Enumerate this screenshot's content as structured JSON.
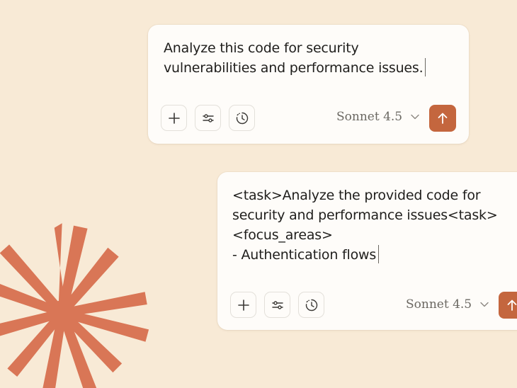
{
  "colors": {
    "background": "#f8ead6",
    "card": "#fefcf9",
    "accent": "#c4663e",
    "starburst": "#d97656",
    "text": "#1f1e1c",
    "muted": "#6b6862"
  },
  "cards": [
    {
      "prompt_lines": [
        "Analyze this code for security",
        "vulnerabilities and performance issues."
      ],
      "tools": [
        "plus-icon",
        "sliders-icon",
        "history-clock-icon"
      ],
      "model_label": "Sonnet 4.5",
      "send_icon": "arrow-up-icon"
    },
    {
      "prompt_lines": [
        "<task>Analyze the provided code for",
        "security and performance issues<task>",
        "<focus_areas>",
        "- Authentication flows"
      ],
      "tools": [
        "plus-icon",
        "sliders-icon",
        "history-clock-icon"
      ],
      "model_label": "Sonnet 4.5",
      "send_icon": "arrow-up-icon"
    }
  ]
}
